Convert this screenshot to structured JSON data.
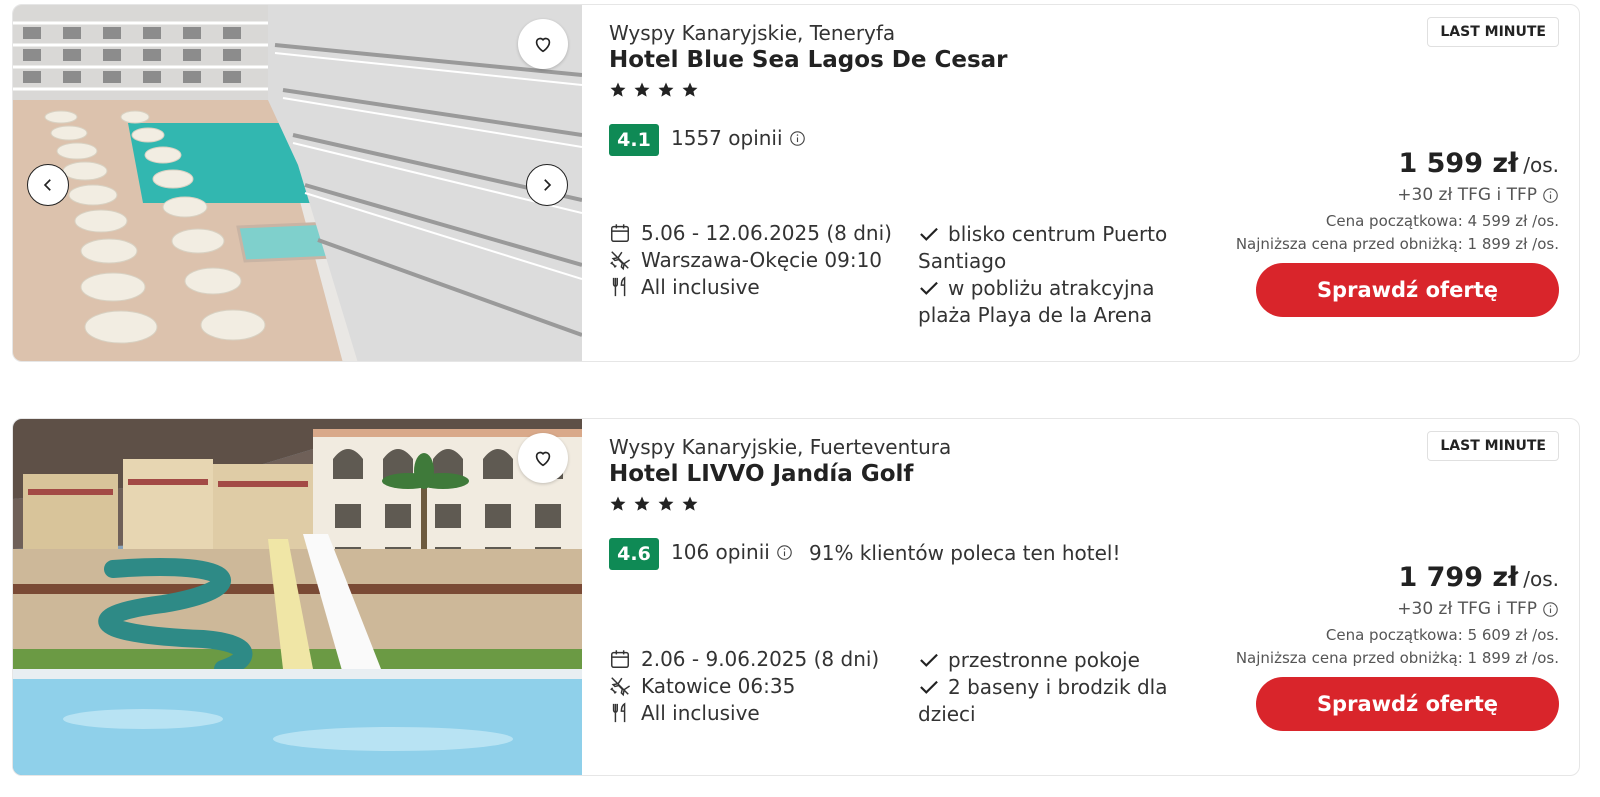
{
  "offers": [
    {
      "location": "Wyspy Kanaryjskie, Teneryfa",
      "hotel_name": "Hotel Blue Sea Lagos De Cesar",
      "stars": 4,
      "rating": "4.1",
      "reviews": "1557 opinii",
      "recommend": "",
      "dates": "5.06 - 12.06.2025 (8 dni)",
      "departure": "Warszawa-Okęcie 09:10",
      "board": "All inclusive",
      "features": [
        "blisko centrum Puerto Santiago",
        "w pobliżu atrakcyjna plaża Playa de la Arena"
      ],
      "badge": "LAST MINUTE",
      "price": "1 599 zł",
      "price_unit": "/os.",
      "fees": "+30 zł TFG i TFP",
      "start_price": "Cena początkowa: 4 599 zł /os.",
      "lowest_price": "Najniższa cena przed obniżką: 1 899 zł /os.",
      "cta": "Sprawdź ofertę"
    },
    {
      "location": "Wyspy Kanaryjskie, Fuerteventura",
      "hotel_name": "Hotel LIVVO Jandía Golf",
      "stars": 4,
      "rating": "4.6",
      "reviews": "106 opinii",
      "recommend": "91% klientów poleca ten hotel!",
      "dates": "2.06 - 9.06.2025 (8 dni)",
      "departure": "Katowice 06:35",
      "board": "All inclusive",
      "features": [
        "przestronne pokoje",
        "2 baseny i brodzik dla dzieci"
      ],
      "badge": "LAST MINUTE",
      "price": "1 799 zł",
      "price_unit": "/os.",
      "fees": "+30 zł TFG i TFP",
      "start_price": "Cena początkowa: 5 609 zł /os.",
      "lowest_price": "Najniższa cena przed obniżką: 1 899 zł /os.",
      "cta": "Sprawdź ofertę"
    }
  ],
  "icons": {
    "favorite": "heart-outline-icon",
    "prev": "chevron-left-icon",
    "next": "chevron-right-icon",
    "star": "star-icon",
    "info": "info-circle-icon",
    "calendar": "calendar-icon",
    "flight": "airplane-icon",
    "board": "cutlery-icon",
    "feature": "checkmark-icon"
  },
  "colors": {
    "rating_bg": "#0f8a55",
    "cta_bg": "#d9252b",
    "text": "#222222"
  }
}
